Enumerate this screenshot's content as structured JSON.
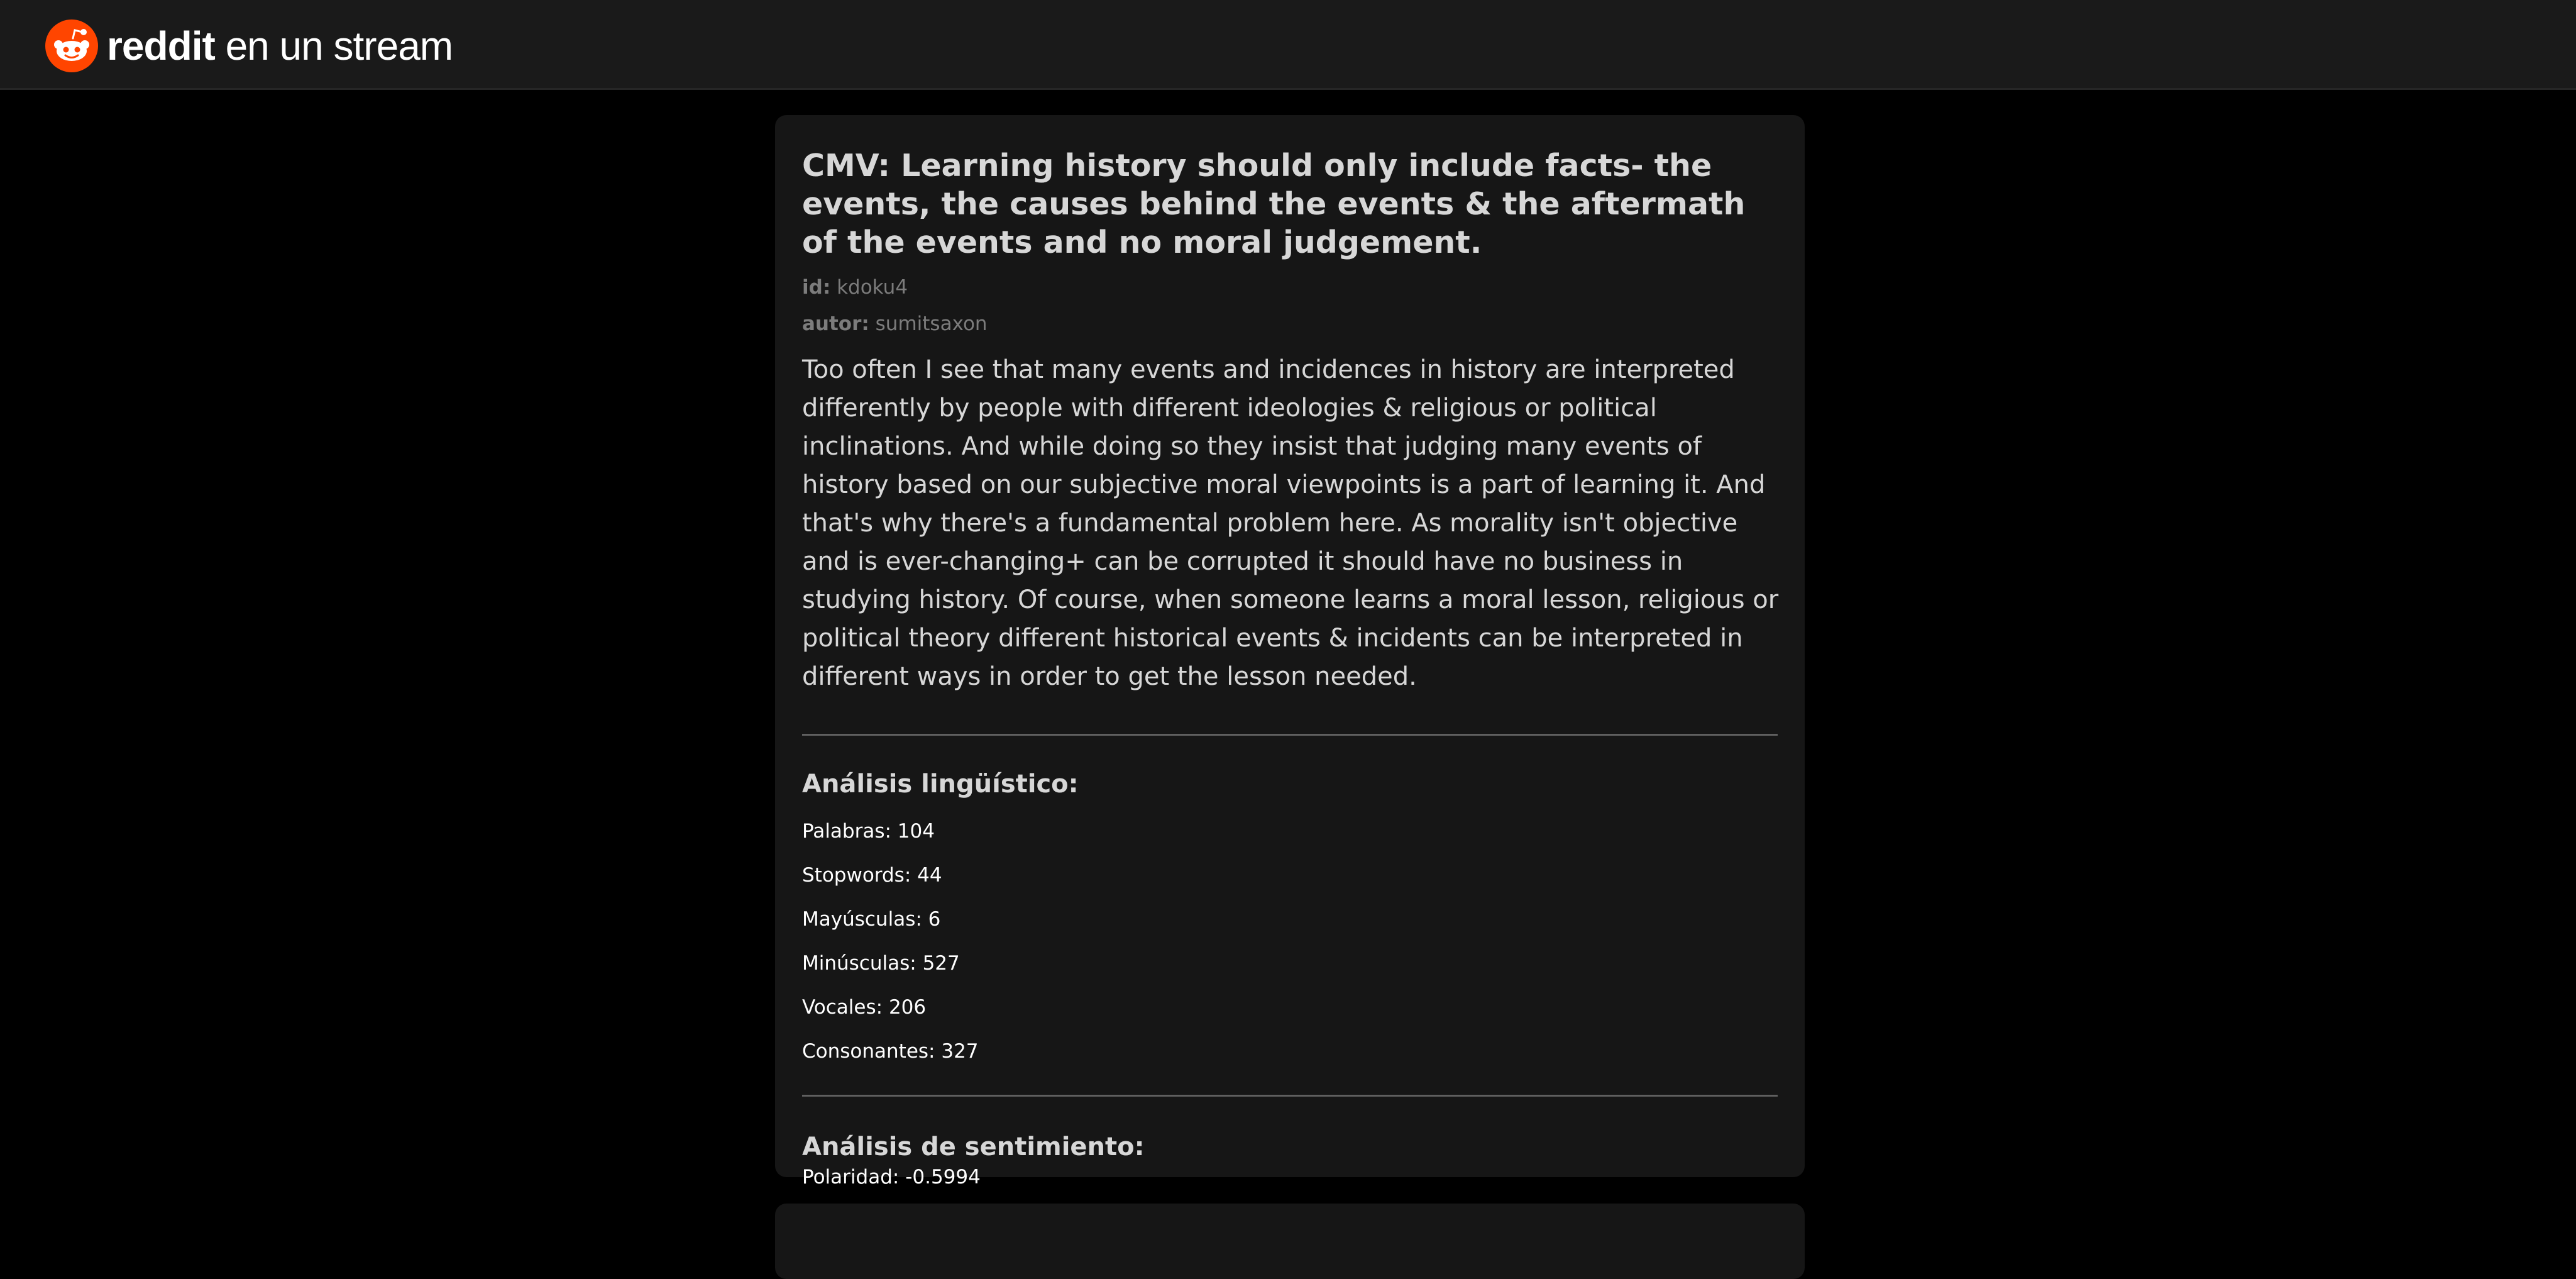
{
  "header": {
    "brand_bold": "reddit",
    "brand_rest": " en un stream",
    "logo_icon": "reddit-snoo-icon",
    "brand_color": "#ff4500"
  },
  "post": {
    "title": "CMV: Learning history should only include facts- the events, the causes behind the events & the aftermath of the events and no moral judgement.",
    "id_label": "id:",
    "id_value": "kdoku4",
    "author_label": "autor:",
    "author_value": "sumitsaxon",
    "body": "Too often I see that many events and incidences in history are interpreted differently by people with different ideologies & religious or political inclinations. And while doing so they insist that judging many events of history based on our subjective moral viewpoints is a part of learning it. And that's why there's a fundamental problem here. As morality isn't objective and is ever-changing+ can be corrupted it should have no business in studying history. Of course, when someone learns a moral lesson, religious or political theory different historical events & incidents can be interpreted in different ways in order to get the lesson needed."
  },
  "linguistic": {
    "title": "Análisis lingüístico:",
    "stats": [
      {
        "label": "Palabras: ",
        "value": "104"
      },
      {
        "label": "Stopwords: ",
        "value": "44"
      },
      {
        "label": "Mayúsculas: ",
        "value": "6"
      },
      {
        "label": "Minúsculas: ",
        "value": "527"
      },
      {
        "label": "Vocales: ",
        "value": "206"
      },
      {
        "label": "Consonantes: ",
        "value": "327"
      }
    ]
  },
  "sentiment": {
    "title": "Análisis de sentimiento:",
    "polarity_label": "Polaridad: ",
    "polarity_value": "-0.5994"
  }
}
